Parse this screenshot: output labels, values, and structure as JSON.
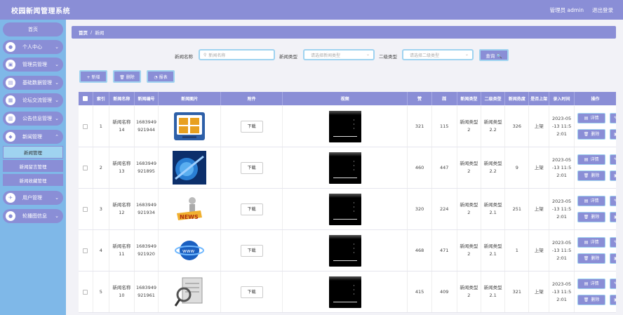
{
  "app": {
    "title": "校园新闻管理系统",
    "admin_label": "管理员 admin",
    "logout": "退出登录"
  },
  "sidebar": {
    "home": "首页",
    "items": [
      {
        "label": "个人中心",
        "icon": "user-icon"
      },
      {
        "label": "管理员管理",
        "icon": "admin-icon"
      },
      {
        "label": "基础数据管理",
        "icon": "database-icon"
      },
      {
        "label": "论坛交流管理",
        "icon": "forum-icon"
      },
      {
        "label": "公告信息管理",
        "icon": "notice-icon"
      },
      {
        "label": "新闻管理",
        "icon": "news-icon"
      }
    ],
    "sub_items": [
      "新闻管理",
      "新闻留言管理",
      "新闻收藏管理"
    ],
    "bottom_items": [
      {
        "label": "用户管理",
        "icon": "users-icon"
      },
      {
        "label": "轮播图信息",
        "icon": "carousel-icon"
      }
    ]
  },
  "breadcrumb": {
    "home": "首页",
    "separator": "/",
    "current": "新闻"
  },
  "search": {
    "name_label": "新闻名称",
    "name_placeholder": "新闻名称",
    "type_label": "新闻类型",
    "type_placeholder": "请选择新闻类型",
    "subtype_label": "二级类型",
    "subtype_placeholder": "请选择二级类型",
    "query_button": "查询 🔍"
  },
  "actions": {
    "add": "+ 新增",
    "delete": "🗑 删除",
    "report": "◔ 报表"
  },
  "table": {
    "headers": [
      "索引",
      "新闻名称",
      "新闻编号",
      "新闻图片",
      "附件",
      "视频",
      "赞",
      "踩",
      "新闻类型",
      "二级类型",
      "新闻热度",
      "是否上架",
      "录入时间",
      "操作"
    ],
    "download": "下载",
    "detail": "详情",
    "remove": "删除",
    "edit": "修",
    "down": "下",
    "rows": [
      {
        "index": "1",
        "name_a": "新闻名称",
        "name_b": "14",
        "no_a": "1683949",
        "no_b": "921944",
        "img": "news-thumb-1",
        "like": "321",
        "dislike": "115",
        "type_a": "新闻类型",
        "type_b": "2",
        "sub_a": "新闻类型",
        "sub_b": "2.2",
        "hot": "326",
        "shelf": "上架",
        "t1": "2023-05",
        "t2": "-13 11:5",
        "t3": "2:01"
      },
      {
        "index": "2",
        "name_a": "新闻名称",
        "name_b": "13",
        "no_a": "1683949",
        "no_b": "921895",
        "img": "news-thumb-2",
        "like": "460",
        "dislike": "447",
        "type_a": "新闻类型",
        "type_b": "2",
        "sub_a": "新闻类型",
        "sub_b": "2.2",
        "hot": "9",
        "shelf": "上架",
        "t1": "2023-05",
        "t2": "-13 11:5",
        "t3": "2:01"
      },
      {
        "index": "3",
        "name_a": "新闻名称",
        "name_b": "12",
        "no_a": "1683949",
        "no_b": "921934",
        "img": "news-thumb-3",
        "like": "320",
        "dislike": "224",
        "type_a": "新闻类型",
        "type_b": "2",
        "sub_a": "新闻类型",
        "sub_b": "2.1",
        "hot": "251",
        "shelf": "上架",
        "t1": "2023-05",
        "t2": "-13 11:5",
        "t3": "2:01"
      },
      {
        "index": "4",
        "name_a": "新闻名称",
        "name_b": "11",
        "no_a": "1683949",
        "no_b": "921920",
        "img": "news-thumb-4",
        "like": "468",
        "dislike": "471",
        "type_a": "新闻类型",
        "type_b": "2",
        "sub_a": "新闻类型",
        "sub_b": "2.1",
        "hot": "1",
        "shelf": "上架",
        "t1": "2023-05",
        "t2": "-13 11:5",
        "t3": "2:01"
      },
      {
        "index": "5",
        "name_a": "新闻名称",
        "name_b": "10",
        "no_a": "1683949",
        "no_b": "921961",
        "img": "news-thumb-5",
        "like": "415",
        "dislike": "409",
        "type_a": "新闻类型",
        "type_b": "2",
        "sub_a": "新闻类型",
        "sub_b": "2.1",
        "hot": "321",
        "shelf": "上架",
        "t1": "2023-05",
        "t2": "-13 11:5",
        "t3": "2:01"
      }
    ]
  },
  "colors": {
    "primary": "#8a8ed6",
    "sidebar": "#7fb8e8",
    "accent_border": "#9fd3f0"
  }
}
